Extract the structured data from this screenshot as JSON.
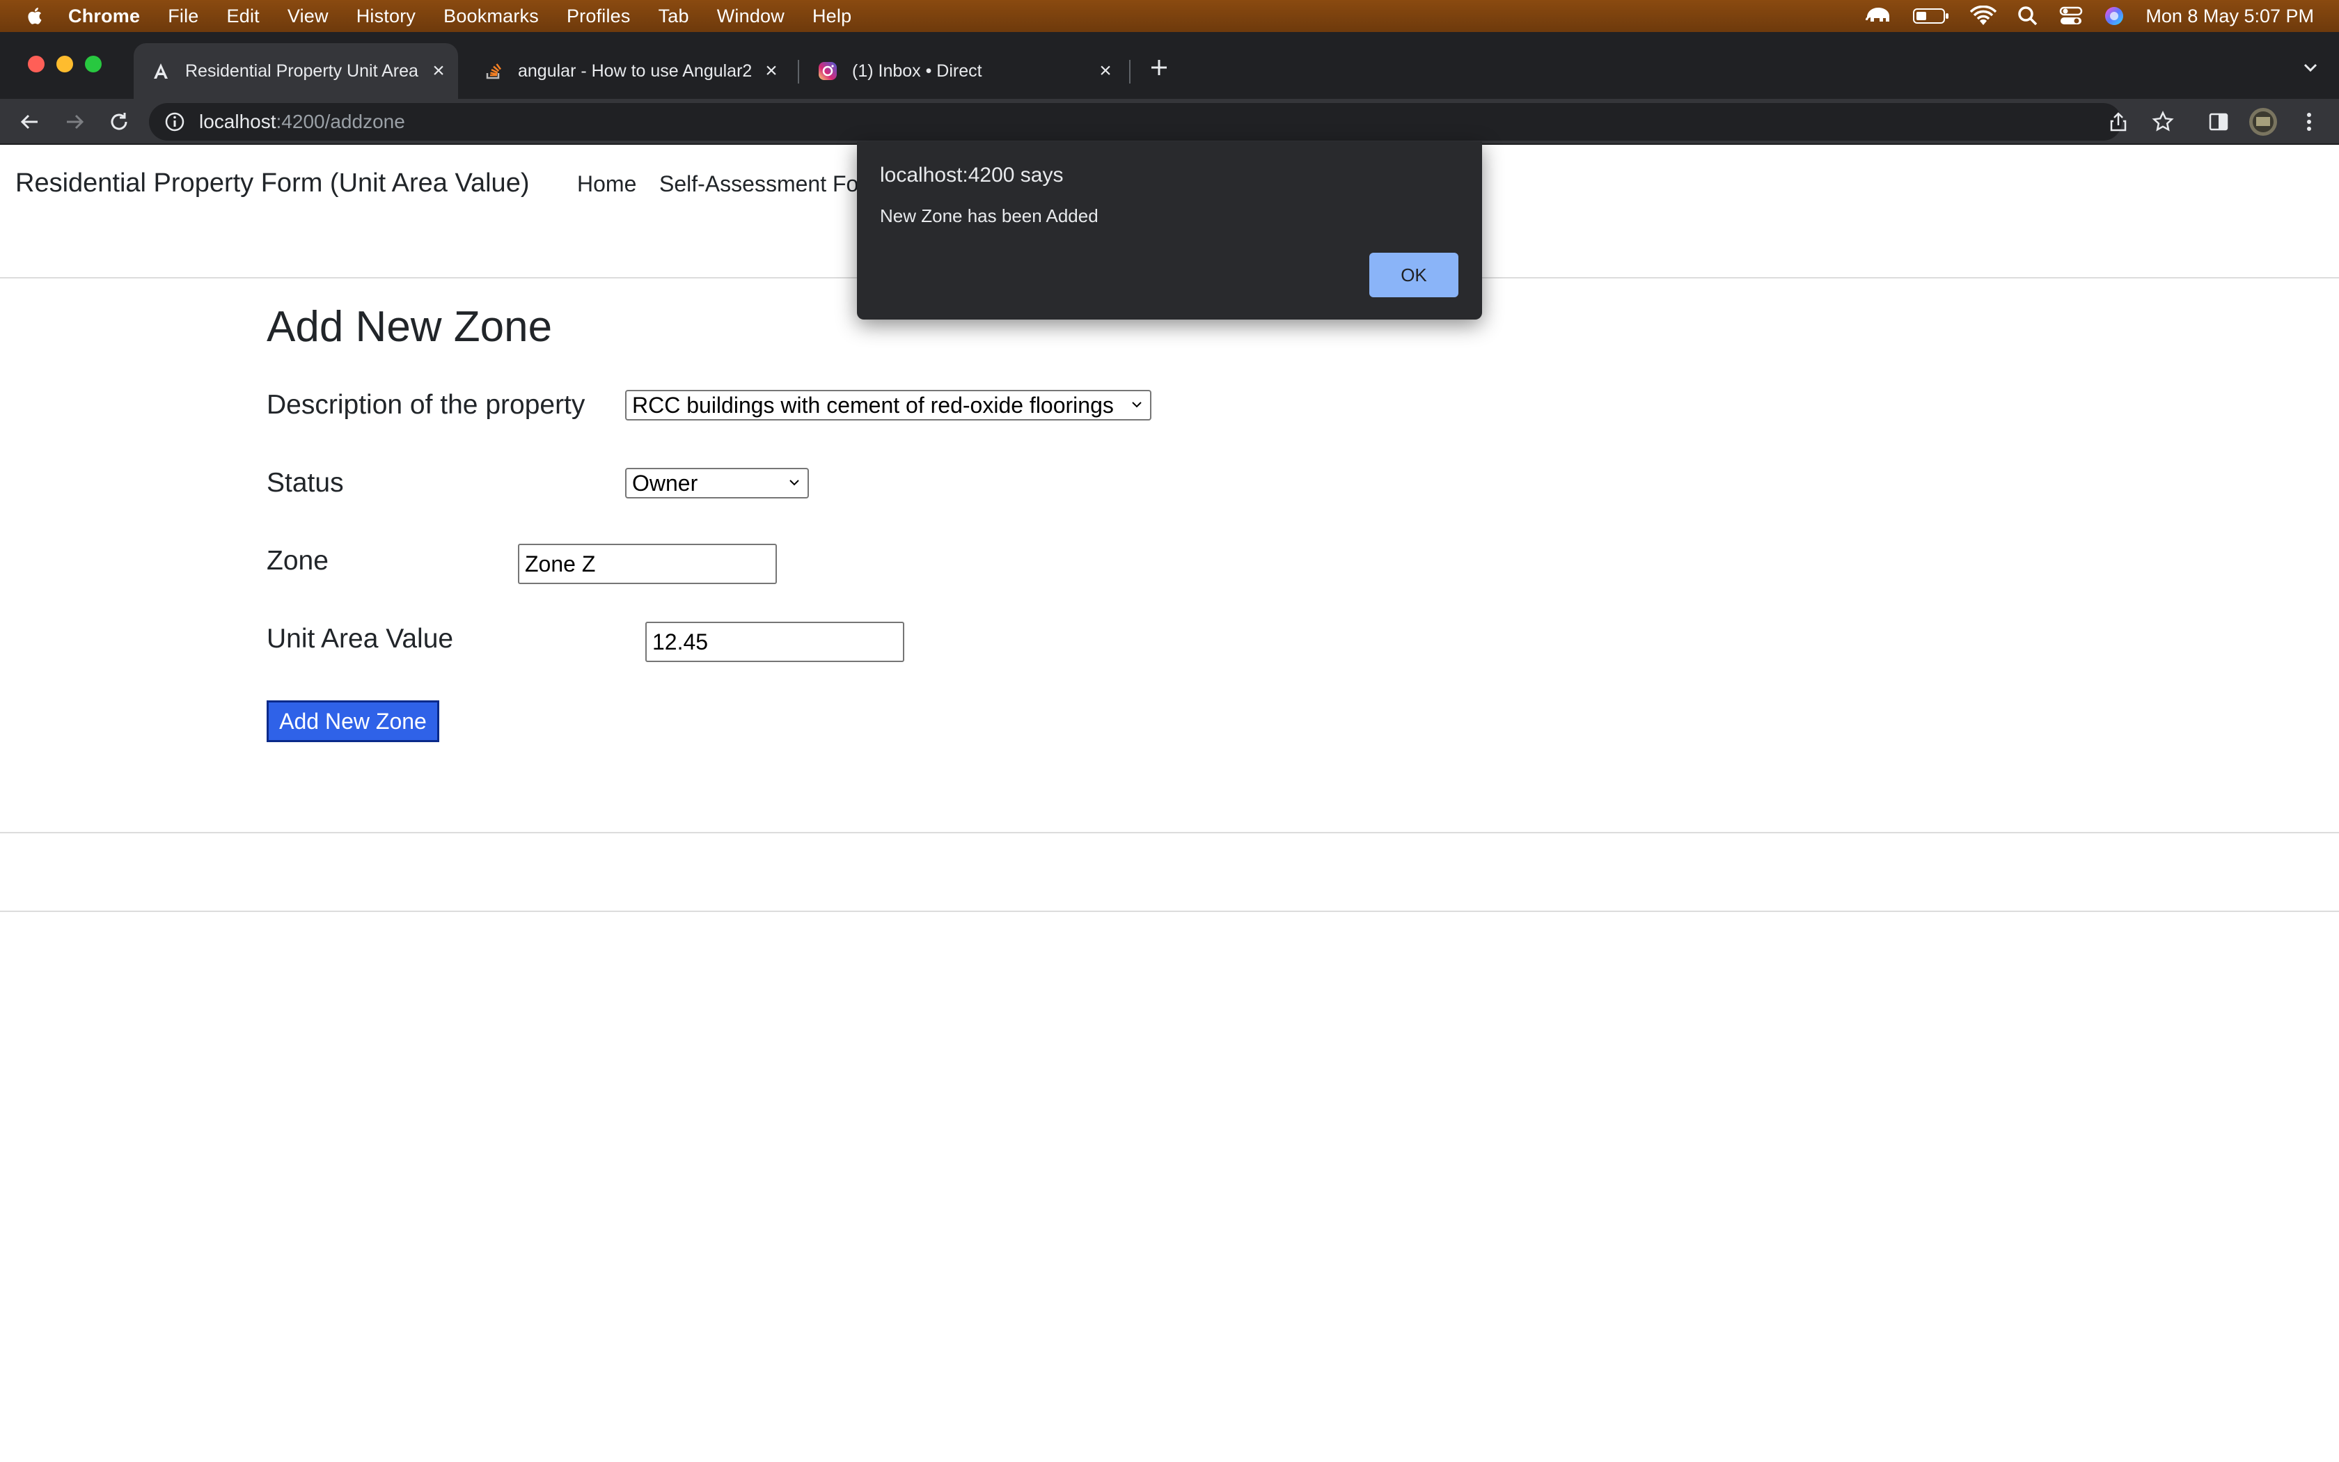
{
  "menubar": {
    "app_name": "Chrome",
    "items": [
      "File",
      "Edit",
      "View",
      "History",
      "Bookmarks",
      "Profiles",
      "Tab",
      "Window",
      "Help"
    ],
    "clock": "Mon 8 May  5:07 PM"
  },
  "browser": {
    "tabs": [
      {
        "title": "Residential Property Unit Area",
        "favicon": "angular-icon",
        "active": true
      },
      {
        "title": "angular - How to use Angular2",
        "favicon": "stackoverflow-icon",
        "active": false
      },
      {
        "title": "(1) Inbox • Direct",
        "favicon": "instagram-icon",
        "active": false
      }
    ],
    "url_host": "localhost",
    "url_path": ":4200/addzone"
  },
  "navbar": {
    "brand": "Residential Property Form (Unit Area Value)",
    "links": [
      "Home",
      "Self-Assessment Fo"
    ]
  },
  "form": {
    "title": "Add New Zone",
    "description_label": "Description of the property",
    "description_value": "RCC buildings with cement of red-oxide floorings",
    "status_label": "Status",
    "status_value": "Owner",
    "zone_label": "Zone",
    "zone_value": "Zone Z",
    "unit_area_label": "Unit Area Value",
    "unit_area_value": "12.45",
    "submit_label": "Add New Zone"
  },
  "alert": {
    "title": "localhost:4200 says",
    "message": "New Zone has been Added",
    "ok_label": "OK"
  },
  "colors": {
    "menubar": "#7a400e",
    "chrome_dark": "#202124",
    "button_blue": "#2f62e8",
    "alert_ok": "#8ab4f8"
  }
}
